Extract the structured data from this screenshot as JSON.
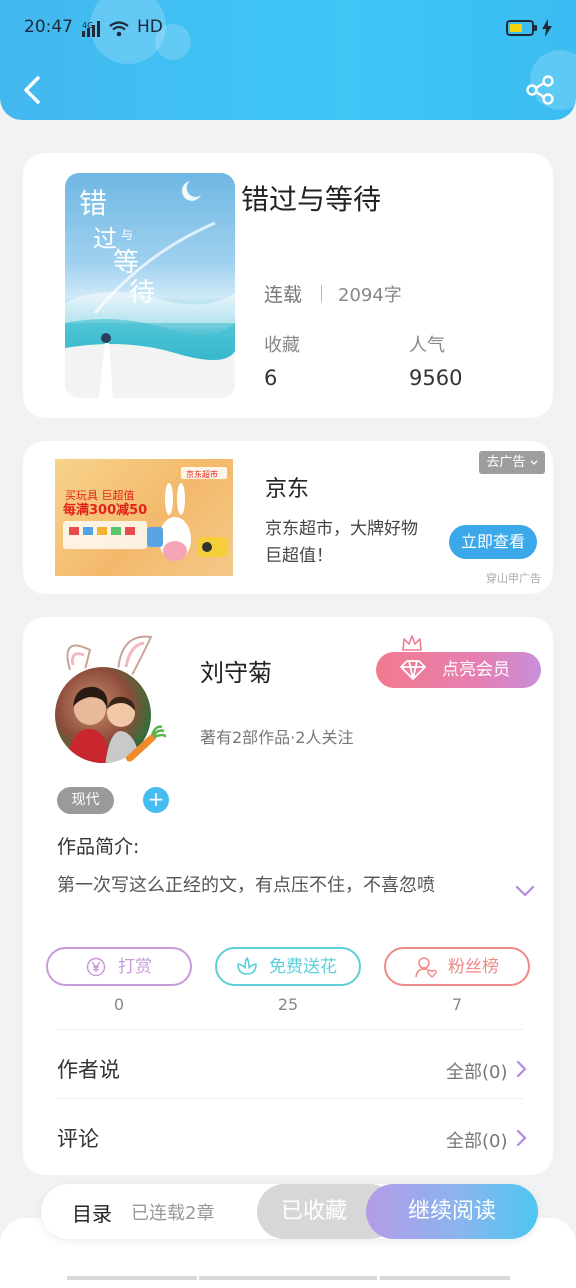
{
  "status_bar": {
    "time": "20:47",
    "network": "4G",
    "hd": "HD"
  },
  "book": {
    "title": "错过与等待",
    "status": "连载",
    "word_count": "2094字",
    "favorites_label": "收藏",
    "favorites_value": "6",
    "popularity_label": "人气",
    "popularity_value": "9560",
    "cover_text": "错过与等待"
  },
  "ad": {
    "title": "京东",
    "description": "京东超市，大牌好物巨超值！",
    "button": "立即查看",
    "remove_label": "去广告",
    "source": "穿山甲广告",
    "image_brand": "京东超市",
    "image_line1": "买玩具 巨超值",
    "image_line2": "每满300减50"
  },
  "author": {
    "name": "刘守菊",
    "meta": "著有2部作品·2人关注",
    "vip_button": "点亮会员",
    "genre_tag": "现代",
    "add_tag": "+",
    "intro_label": "作品简介:",
    "intro_text": "第一次写这么正经的文，有点压不住，不喜忽喷"
  },
  "actions": [
    {
      "label": "打赏",
      "count": "0",
      "color": "#c99ad9"
    },
    {
      "label": "免费送花",
      "count": "25",
      "color": "#5ccfd9"
    },
    {
      "label": "粉丝榜",
      "count": "7",
      "color": "#ef8a86"
    }
  ],
  "rows": [
    {
      "label": "作者说",
      "value": "全部(0)"
    },
    {
      "label": "评论",
      "value": "全部(0)"
    }
  ],
  "bottom_bar": {
    "toc_label": "目录",
    "toc_count": "已连载2章",
    "favorited": "已收藏",
    "continue_reading": "继续阅读"
  },
  "colors": {
    "header": "#3ec6f5",
    "accent": "#3aa8e9",
    "chevron": "#b38be0"
  }
}
